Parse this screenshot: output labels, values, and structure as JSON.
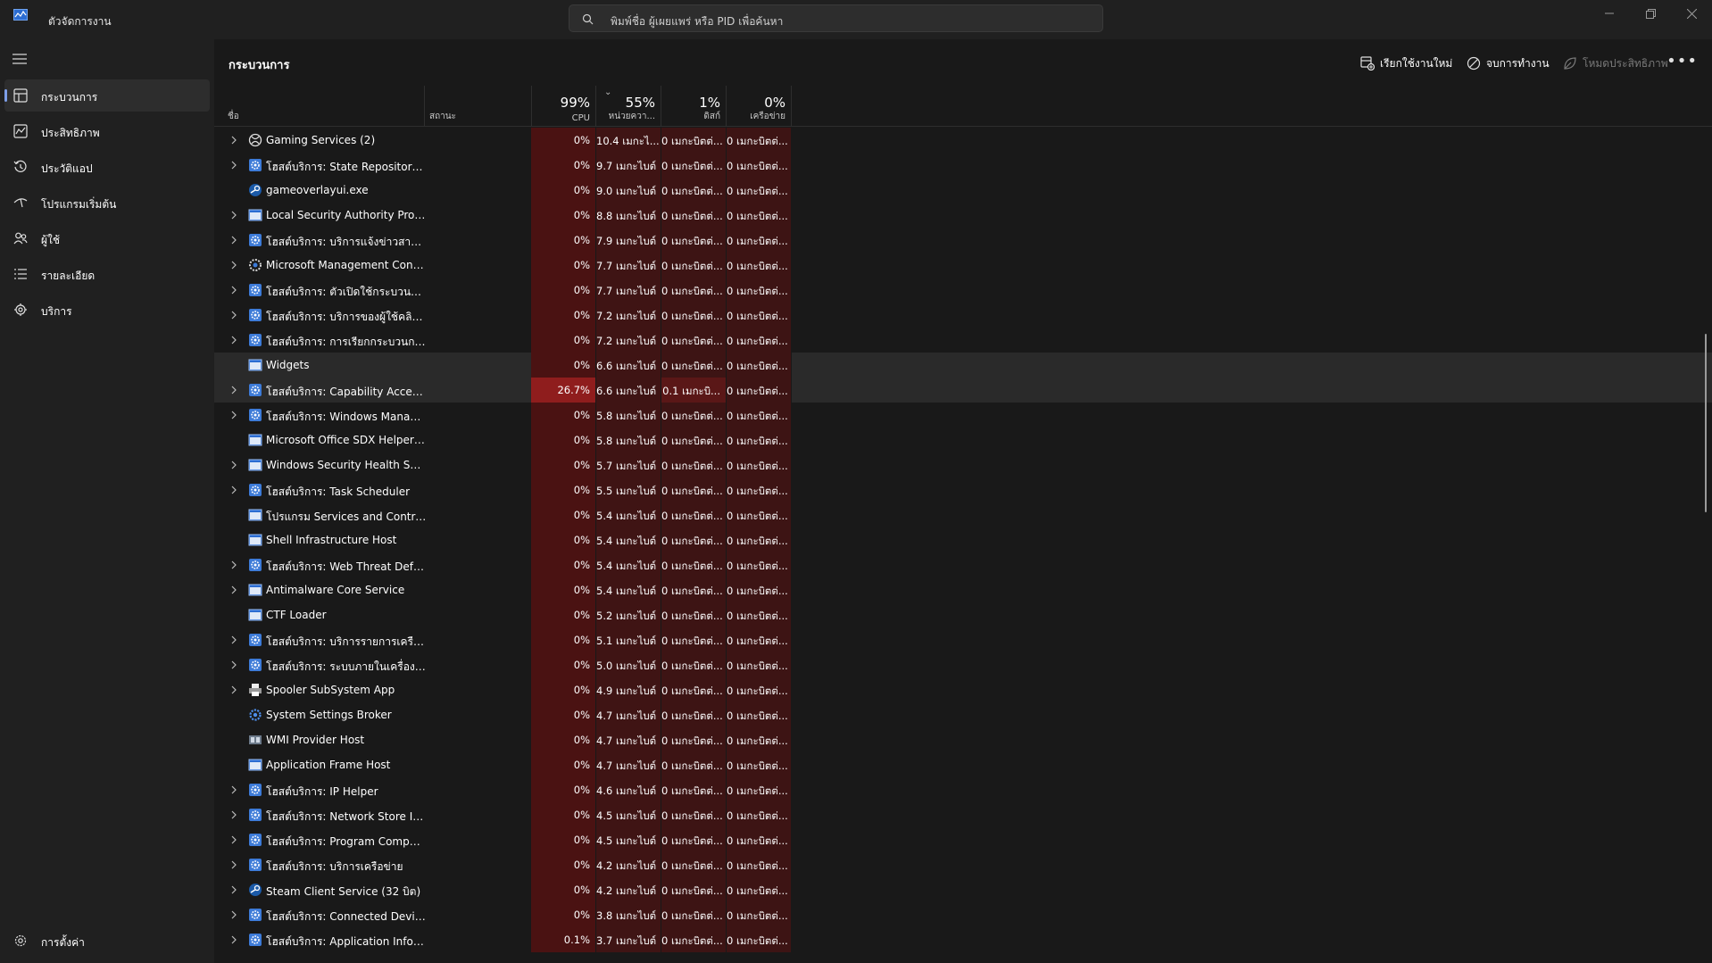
{
  "app": {
    "title": "ตัวจัดการงาน"
  },
  "search": {
    "placeholder": "พิมพ์ชื่อ ผู้เผยแพร่ หรือ PID เพื่อค้นหา"
  },
  "sidebar": {
    "items": [
      {
        "label": "กระบวนการ",
        "icon": "processes-icon",
        "selected": true
      },
      {
        "label": "ประสิทธิภาพ",
        "icon": "performance-icon"
      },
      {
        "label": "ประวัติแอป",
        "icon": "history-icon"
      },
      {
        "label": "โปรแกรมเริ่มต้น",
        "icon": "startup-icon"
      },
      {
        "label": "ผู้ใช้",
        "icon": "users-icon"
      },
      {
        "label": "รายละเอียด",
        "icon": "details-icon"
      },
      {
        "label": "บริการ",
        "icon": "services-icon"
      }
    ],
    "settings_label": "การตั้งค่า"
  },
  "toolbar": {
    "page_title": "กระบวนการ",
    "run_new_task": "เรียกใช้งานใหม่",
    "end_task": "จบการทำงาน",
    "efficiency_mode": "โหมดประสิทธิภาพ"
  },
  "columns": {
    "name": "ชื่อ",
    "status": "สถานะ",
    "cpu": {
      "percent": "99%",
      "label": "CPU"
    },
    "memory": {
      "percent": "55%",
      "label": "หน่วยควา..."
    },
    "disk": {
      "percent": "1%",
      "label": "ดิสก์"
    },
    "network": {
      "percent": "0%",
      "label": "เครือข่าย"
    }
  },
  "processes": [
    {
      "name": "Gaming Services (2)",
      "expandable": true,
      "icon": "xbox-icon",
      "cpu": "0%",
      "memory": "10.4 เมกะไ...",
      "disk": "0 เมกะบิตต่...",
      "network": "0 เมกะบิตต่..."
    },
    {
      "name": "โฮสต์บริการ: State Repository Se...",
      "expandable": true,
      "icon": "service-gear-icon",
      "cpu": "0%",
      "memory": "9.7 เมกะไบต์",
      "disk": "0 เมกะบิตต่...",
      "network": "0 เมกะบิตต่..."
    },
    {
      "name": "gameoverlayui.exe",
      "expandable": false,
      "icon": "steam-icon",
      "cpu": "0%",
      "memory": "9.0 เมกะไบต์",
      "disk": "0 เมกะบิตต่...",
      "network": "0 เมกะบิตต่..."
    },
    {
      "name": "Local Security Authority Proce...",
      "expandable": true,
      "icon": "window-icon",
      "cpu": "0%",
      "memory": "8.8 เมกะไบต์",
      "disk": "0 เมกะบิตต่...",
      "network": "0 เมกะบิตต่..."
    },
    {
      "name": "โฮสต์บริการ: บริการแจ้งข่าวสารของ ...",
      "expandable": true,
      "icon": "service-gear-icon",
      "cpu": "0%",
      "memory": "7.9 เมกะไบต์",
      "disk": "0 เมกะบิตต่...",
      "network": "0 เมกะบิตต่..."
    },
    {
      "name": "Microsoft Management Cons...",
      "expandable": true,
      "icon": "mmc-icon",
      "cpu": "0%",
      "memory": "7.7 เมกะไบต์",
      "disk": "0 เมกะบิตต่...",
      "network": "0 เมกะบิตต่..."
    },
    {
      "name": "โฮสต์บริการ: ตัวเปิดใช้กระบวนการเซิ...",
      "expandable": true,
      "icon": "service-gear-icon",
      "cpu": "0%",
      "memory": "7.7 เมกะไบต์",
      "disk": "0 เมกะบิตต่...",
      "network": "0 เมกะบิตต่..."
    },
    {
      "name": "โฮสต์บริการ: บริการของผู้ใช้คลิปบอ...",
      "expandable": true,
      "icon": "service-gear-icon",
      "cpu": "0%",
      "memory": "7.2 เมกะไบต์",
      "disk": "0 เมกะบิตต่...",
      "network": "0 เมกะบิตต่..."
    },
    {
      "name": "โฮสต์บริการ: การเรียกกระบวนการระ...",
      "expandable": true,
      "icon": "service-gear-icon",
      "cpu": "0%",
      "memory": "7.2 เมกะไบต์",
      "disk": "0 เมกะบิตต่...",
      "network": "0 เมกะบิตต่..."
    },
    {
      "name": "Widgets",
      "expandable": false,
      "icon": "window-icon",
      "cpu": "0%",
      "memory": "6.6 เมกะไบต์",
      "disk": "0 เมกะบิตต่...",
      "network": "0 เมกะบิตต่...",
      "highlight": true
    },
    {
      "name": "โฮสต์บริการ: Capability Access ...",
      "expandable": true,
      "icon": "service-gear-icon",
      "cpu": "26.7%",
      "memory": "6.6 เมกะไบต์",
      "disk": "0.1 เมกะบิ...",
      "network": "0 เมกะบิตต่...",
      "highlight": true,
      "hot": true
    },
    {
      "name": "โฮสต์บริการ: Windows Manage...",
      "expandable": true,
      "icon": "service-gear-icon",
      "cpu": "0%",
      "memory": "5.8 เมกะไบต์",
      "disk": "0 เมกะบิตต่...",
      "network": "0 เมกะบิตต่..."
    },
    {
      "name": "Microsoft Office SDX Helper (...",
      "expandable": false,
      "icon": "window-icon",
      "cpu": "0%",
      "memory": "5.8 เมกะไบต์",
      "disk": "0 เมกะบิตต่...",
      "network": "0 เมกะบิตต่..."
    },
    {
      "name": "Windows Security Health Servi...",
      "expandable": true,
      "icon": "window-icon",
      "cpu": "0%",
      "memory": "5.7 เมกะไบต์",
      "disk": "0 เมกะบิตต่...",
      "network": "0 เมกะบิตต่..."
    },
    {
      "name": "โฮสต์บริการ: Task Scheduler",
      "expandable": true,
      "icon": "service-gear-icon",
      "cpu": "0%",
      "memory": "5.5 เมกะไบต์",
      "disk": "0 เมกะบิตต่...",
      "network": "0 เมกะบิตต่..."
    },
    {
      "name": "โปรแกรม Services and Controller",
      "expandable": false,
      "icon": "window-icon",
      "cpu": "0%",
      "memory": "5.4 เมกะไบต์",
      "disk": "0 เมกะบิตต่...",
      "network": "0 เมกะบิตต่..."
    },
    {
      "name": "Shell Infrastructure Host",
      "expandable": false,
      "icon": "window-icon",
      "cpu": "0%",
      "memory": "5.4 เมกะไบต์",
      "disk": "0 เมกะบิตต่...",
      "network": "0 เมกะบิตต่..."
    },
    {
      "name": "โฮสต์บริการ: Web Threat Defens...",
      "expandable": true,
      "icon": "service-gear-icon",
      "cpu": "0%",
      "memory": "5.4 เมกะไบต์",
      "disk": "0 เมกะบิตต่...",
      "network": "0 เมกะบิตต่..."
    },
    {
      "name": "Antimalware Core Service",
      "expandable": true,
      "icon": "window-icon",
      "cpu": "0%",
      "memory": "5.4 เมกะไบต์",
      "disk": "0 เมกะบิตต่...",
      "network": "0 เมกะบิตต่..."
    },
    {
      "name": "CTF Loader",
      "expandable": false,
      "icon": "window-icon",
      "cpu": "0%",
      "memory": "5.2 เมกะไบต์",
      "disk": "0 เมกะบิตต่...",
      "network": "0 เมกะบิตต่..."
    },
    {
      "name": "โฮสต์บริการ: บริการรายการเครือข่าย",
      "expandable": true,
      "icon": "service-gear-icon",
      "cpu": "0%",
      "memory": "5.1 เมกะไบต์",
      "disk": "0 เมกะบิตต่...",
      "network": "0 เมกะบิตต่..."
    },
    {
      "name": "โฮสต์บริการ: ระบบภายในเครื่อง (เคร...",
      "expandable": true,
      "icon": "service-gear-icon",
      "cpu": "0%",
      "memory": "5.0 เมกะไบต์",
      "disk": "0 เมกะบิตต่...",
      "network": "0 เมกะบิตต่..."
    },
    {
      "name": "Spooler SubSystem App",
      "expandable": true,
      "icon": "printer-icon",
      "cpu": "0%",
      "memory": "4.9 เมกะไบต์",
      "disk": "0 เมกะบิตต่...",
      "network": "0 เมกะบิตต่..."
    },
    {
      "name": "System Settings Broker",
      "expandable": false,
      "icon": "settings-gear-icon",
      "cpu": "0%",
      "memory": "4.7 เมกะไบต์",
      "disk": "0 เมกะบิตต่...",
      "network": "0 เมกะบิตต่..."
    },
    {
      "name": "WMI Provider Host",
      "expandable": false,
      "icon": "wmi-icon",
      "cpu": "0%",
      "memory": "4.7 เมกะไบต์",
      "disk": "0 เมกะบิตต่...",
      "network": "0 เมกะบิตต่..."
    },
    {
      "name": "Application Frame Host",
      "expandable": false,
      "icon": "window-icon",
      "cpu": "0%",
      "memory": "4.7 เมกะไบต์",
      "disk": "0 เมกะบิตต่...",
      "network": "0 เมกะบิตต่..."
    },
    {
      "name": "โฮสต์บริการ: IP Helper",
      "expandable": true,
      "icon": "service-gear-icon",
      "cpu": "0%",
      "memory": "4.6 เมกะไบต์",
      "disk": "0 เมกะบิตต่...",
      "network": "0 เมกะบิตต่..."
    },
    {
      "name": "โฮสต์บริการ: Network Store Inte...",
      "expandable": true,
      "icon": "service-gear-icon",
      "cpu": "0%",
      "memory": "4.5 เมกะไบต์",
      "disk": "0 เมกะบิตต่...",
      "network": "0 เมกะบิตต่..."
    },
    {
      "name": "โฮสต์บริการ: Program Compati...",
      "expandable": true,
      "icon": "service-gear-icon",
      "cpu": "0%",
      "memory": "4.5 เมกะไบต์",
      "disk": "0 เมกะบิตต่...",
      "network": "0 เมกะบิตต่..."
    },
    {
      "name": "โฮสต์บริการ: บริการเครือข่าย",
      "expandable": true,
      "icon": "service-gear-icon",
      "cpu": "0%",
      "memory": "4.2 เมกะไบต์",
      "disk": "0 เมกะบิตต่...",
      "network": "0 เมกะบิตต่..."
    },
    {
      "name": "Steam Client Service (32 บิต)",
      "expandable": true,
      "icon": "steam-icon",
      "cpu": "0%",
      "memory": "4.2 เมกะไบต์",
      "disk": "0 เมกะบิตต่...",
      "network": "0 เมกะบิตต่..."
    },
    {
      "name": "โฮสต์บริการ: Connected Devices...",
      "expandable": true,
      "icon": "service-gear-icon",
      "cpu": "0%",
      "memory": "3.8 เมกะไบต์",
      "disk": "0 เมกะบิตต่...",
      "network": "0 เมกะบิตต่..."
    },
    {
      "name": "โฮสต์บริการ: Application Inform...",
      "expandable": true,
      "icon": "service-gear-icon",
      "cpu": "0.1%",
      "memory": "3.7 เมกะไบต์",
      "disk": "0 เมกะบิตต่...",
      "network": "0 เมกะบิตต่..."
    }
  ]
}
